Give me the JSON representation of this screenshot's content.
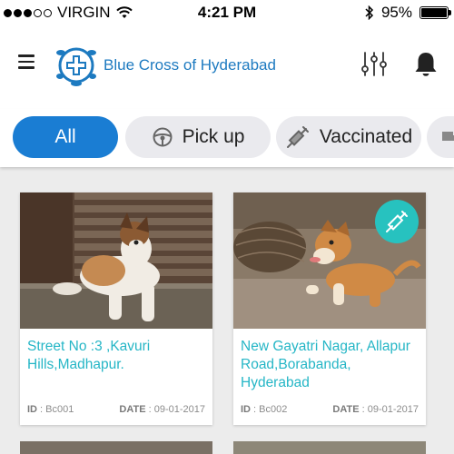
{
  "status_bar": {
    "carrier": "VIRGIN",
    "time": "4:21 PM",
    "battery": "95%"
  },
  "header": {
    "title": "Blue Cross of Hyderabad"
  },
  "filters": [
    {
      "label": "All",
      "icon": "none",
      "active": true
    },
    {
      "label": "Pick up",
      "icon": "steering-wheel-icon",
      "active": false
    },
    {
      "label": "Vaccinated",
      "icon": "syringe-icon",
      "active": false
    }
  ],
  "cards": [
    {
      "address": "Street No :3 ,Kavuri Hills,Madhapur.",
      "id_label": "ID",
      "id_value": "Bc001",
      "date_label": "DATE",
      "date_value": "09-01-2017",
      "vaccinated": false
    },
    {
      "address": "New Gayatri Nagar, Allapur Road,Borabanda, Hyderabad",
      "id_label": "ID",
      "id_value": "Bc002",
      "date_label": "DATE",
      "date_value": "09-01-2017",
      "vaccinated": true
    }
  ],
  "colors": {
    "brand_blue": "#1d7ac0",
    "active_chip": "#1a7dd3",
    "address_teal": "#25b6c6",
    "badge_teal": "#27c2bf"
  }
}
